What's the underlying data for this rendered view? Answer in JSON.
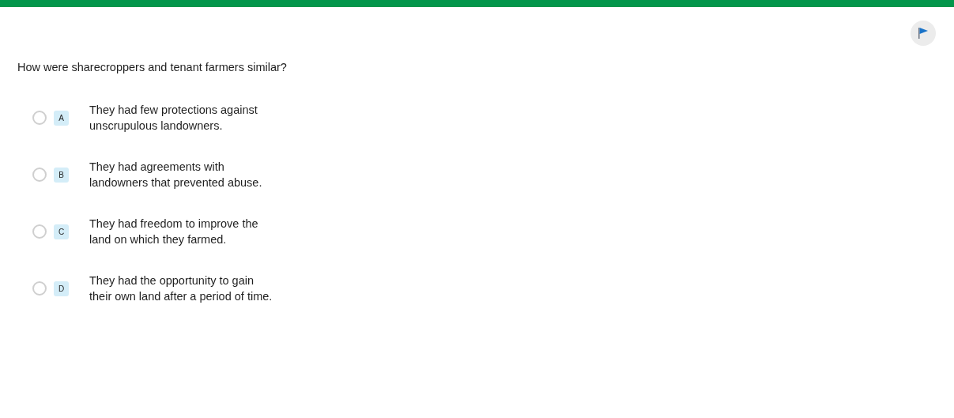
{
  "question": "How were sharecroppers and tenant farmers similar?",
  "flagged": false,
  "options": [
    {
      "letter": "A",
      "text": "They had few protections against unscrupulous landowners.",
      "selected": false
    },
    {
      "letter": "B",
      "text": "They had agreements with landowners that prevented abuse.",
      "selected": false
    },
    {
      "letter": "C",
      "text": "They had freedom to improve the land on which they farmed.",
      "selected": false
    },
    {
      "letter": "D",
      "text": "They had the opportunity to gain their own land after a period of time.",
      "selected": false
    }
  ]
}
